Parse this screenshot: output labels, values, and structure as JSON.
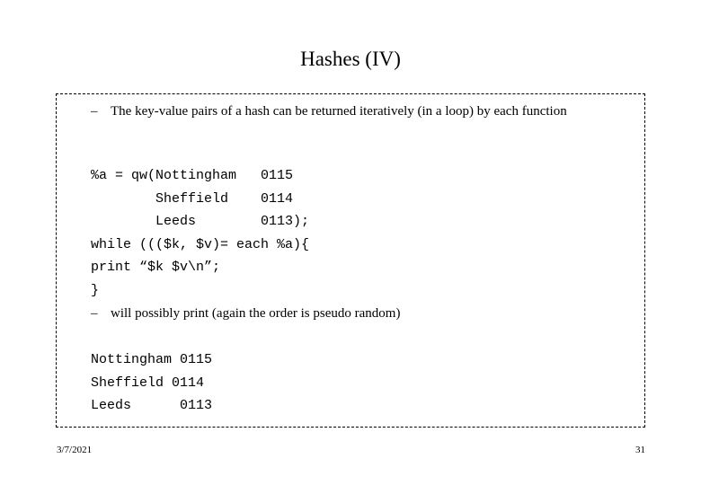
{
  "slide": {
    "title": "Hashes (IV)",
    "bullets": [
      {
        "marker": "–",
        "text": "The key-value pairs of a hash can be returned iteratively (in a loop) by each function"
      },
      {
        "marker": "–",
        "text": "will possibly print (again the order is pseudo random)"
      }
    ],
    "code_blocks": [
      {
        "text": "%a = qw(Nottingham   0115\n        Sheffield    0114\n        Leeds        0113);\nwhile ((($k, $v)= each %a){\nprint “$k $v\\n”;\n}"
      },
      {
        "text": "Nottingham 0115\nSheffield 0114\nLeeds      0113"
      }
    ],
    "footer": {
      "date": "3/7/2021",
      "page_number": "31"
    }
  }
}
